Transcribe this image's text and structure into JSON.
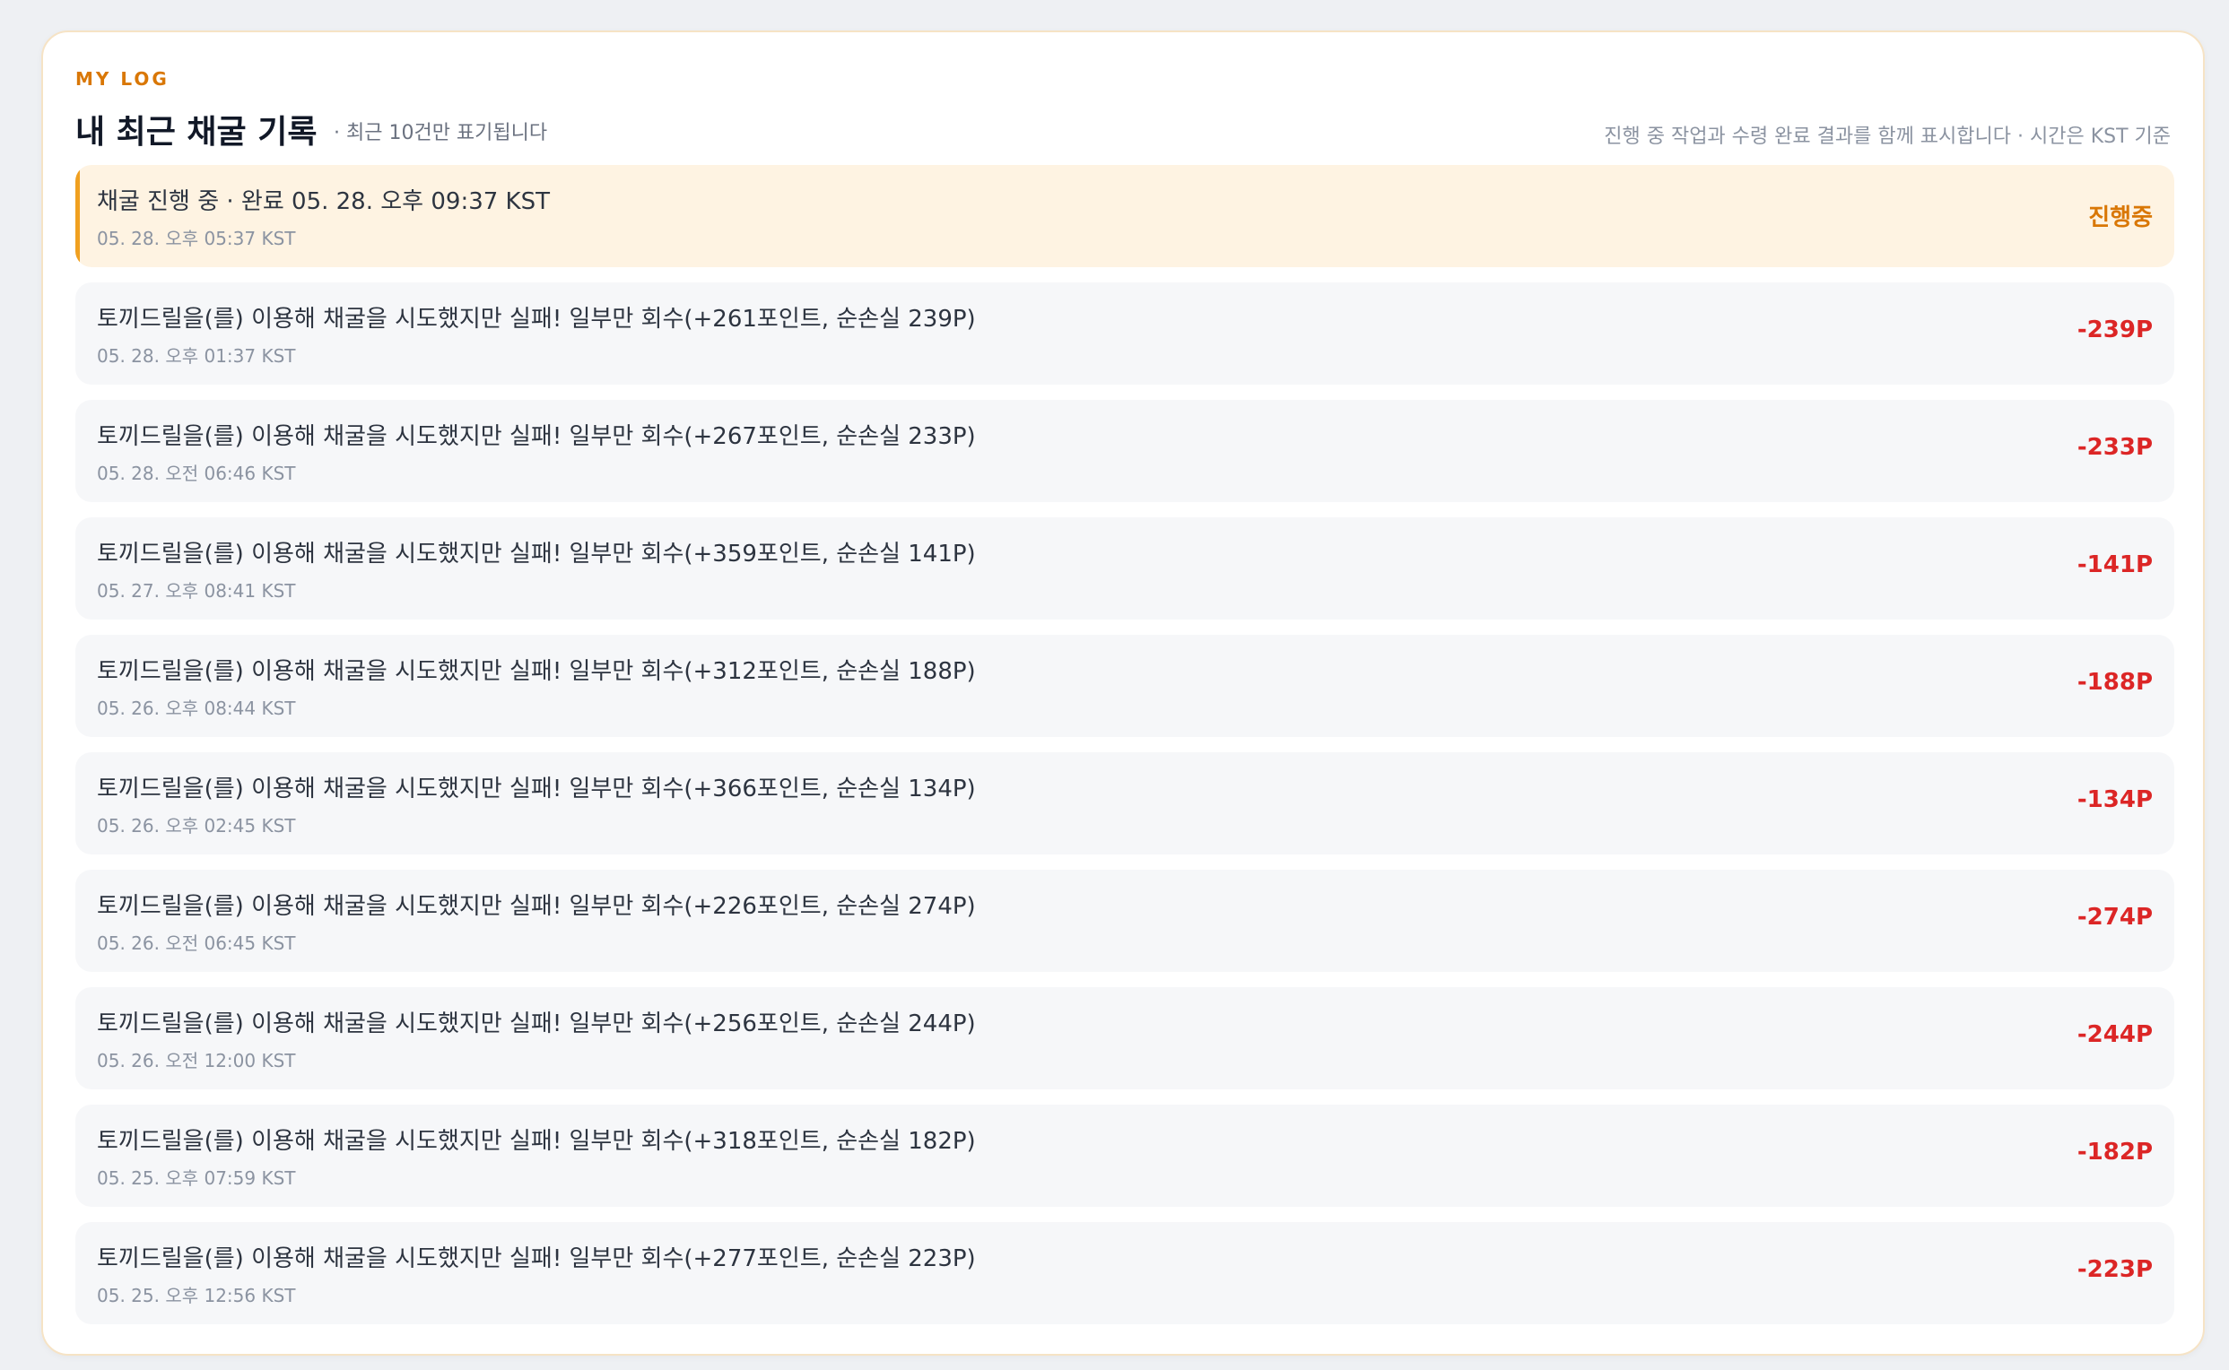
{
  "panel": {
    "eyebrow": "MY LOG",
    "title": "내 최근 채굴 기록",
    "subtitle": "· 최근 10건만 표기됩니다",
    "note": "진행 중 작업과 수령 완료 결과를 함께 표시합니다 · 시간은 KST 기준"
  },
  "colors": {
    "accent": "#d97706",
    "negative": "#dc2626",
    "pending_bg": "#fef3e2",
    "pending_bar": "#f0a020",
    "row_bg": "#f6f7f9"
  },
  "records": [
    {
      "status": "pending",
      "text": "채굴 진행 중 · 완료 05. 28. 오후 09:37 KST",
      "time": "05. 28. 오후 05:37 KST",
      "amount": "진행중"
    },
    {
      "status": "failed",
      "text": "토끼드릴을(를) 이용해 채굴을 시도했지만 실패! 일부만 회수(+261포인트, 순손실 239P)",
      "time": "05. 28. 오후 01:37 KST",
      "amount": "-239P"
    },
    {
      "status": "failed",
      "text": "토끼드릴을(를) 이용해 채굴을 시도했지만 실패! 일부만 회수(+267포인트, 순손실 233P)",
      "time": "05. 28. 오전 06:46 KST",
      "amount": "-233P"
    },
    {
      "status": "failed",
      "text": "토끼드릴을(를) 이용해 채굴을 시도했지만 실패! 일부만 회수(+359포인트, 순손실 141P)",
      "time": "05. 27. 오후 08:41 KST",
      "amount": "-141P"
    },
    {
      "status": "failed",
      "text": "토끼드릴을(를) 이용해 채굴을 시도했지만 실패! 일부만 회수(+312포인트, 순손실 188P)",
      "time": "05. 26. 오후 08:44 KST",
      "amount": "-188P"
    },
    {
      "status": "failed",
      "text": "토끼드릴을(를) 이용해 채굴을 시도했지만 실패! 일부만 회수(+366포인트, 순손실 134P)",
      "time": "05. 26. 오후 02:45 KST",
      "amount": "-134P"
    },
    {
      "status": "failed",
      "text": "토끼드릴을(를) 이용해 채굴을 시도했지만 실패! 일부만 회수(+226포인트, 순손실 274P)",
      "time": "05. 26. 오전 06:45 KST",
      "amount": "-274P"
    },
    {
      "status": "failed",
      "text": "토끼드릴을(를) 이용해 채굴을 시도했지만 실패! 일부만 회수(+256포인트, 순손실 244P)",
      "time": "05. 26. 오전 12:00 KST",
      "amount": "-244P"
    },
    {
      "status": "failed",
      "text": "토끼드릴을(를) 이용해 채굴을 시도했지만 실패! 일부만 회수(+318포인트, 순손실 182P)",
      "time": "05. 25. 오후 07:59 KST",
      "amount": "-182P"
    },
    {
      "status": "failed",
      "text": "토끼드릴을(를) 이용해 채굴을 시도했지만 실패! 일부만 회수(+277포인트, 순손실 223P)",
      "time": "05. 25. 오후 12:56 KST",
      "amount": "-223P"
    }
  ]
}
